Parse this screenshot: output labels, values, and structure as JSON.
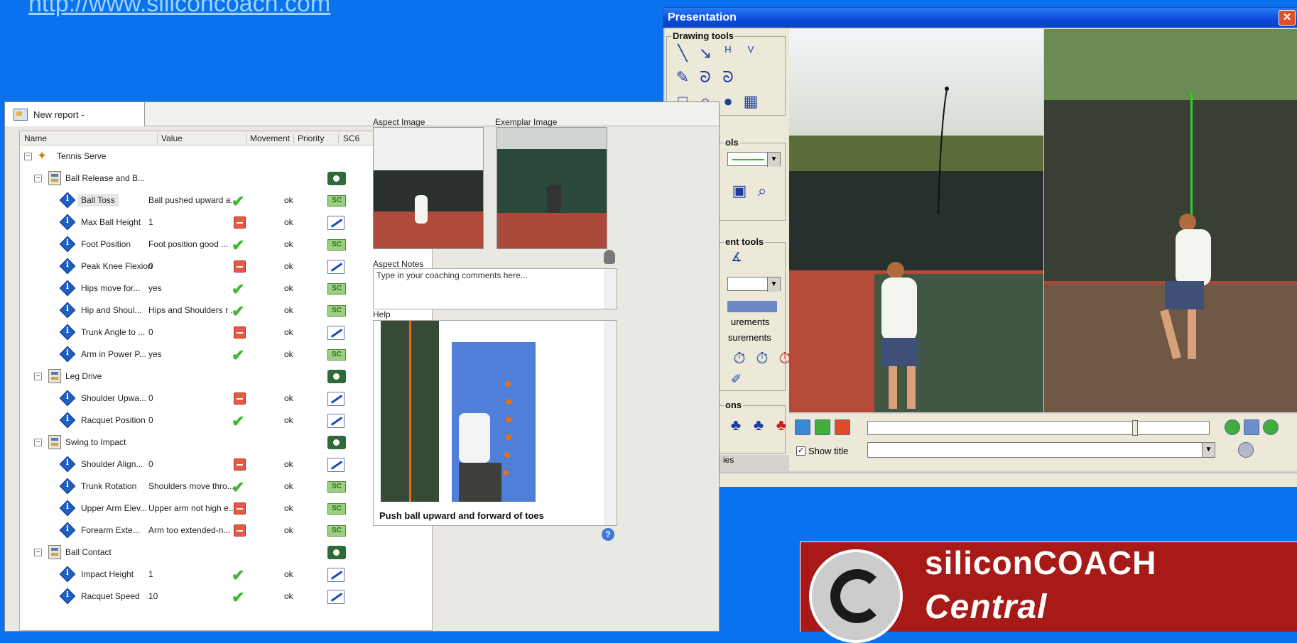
{
  "top_link": "http://www.siliconcoach.com",
  "presentation": {
    "title": "Presentation",
    "close_label": "✕",
    "groups": {
      "drawing_tools": "Drawing tools",
      "tools_partial": "ols",
      "measurement_tools_partial": "ent tools",
      "actions_partial": "ons"
    },
    "measurements_label_1": "urements",
    "measurements_label_2": "surements",
    "series_partial": "ies",
    "show_title_label": "Show title",
    "show_title_checked": "✓"
  },
  "report": {
    "tab_label": "New report -",
    "columns": {
      "name": "Name",
      "value": "Value",
      "movement": "Movement",
      "priority": "Priority",
      "sc6": "SC6"
    },
    "root": "Tennis Serve",
    "aspect_image_label": "Aspect Image",
    "exemplar_image_label": "Exemplar Image",
    "aspect_notes_label": "Aspect Notes",
    "notes_placeholder": "Type in your coaching comments here...",
    "help_label": "Help",
    "help_caption": "Push ball upward and forward of toes",
    "help_icon": "?"
  },
  "rows": [
    {
      "type": "group",
      "name": "Ball Release and B...",
      "icon": "camera"
    },
    {
      "type": "item",
      "name": "Ball Toss",
      "value": "Ball pushed upward a...",
      "movement": "check",
      "priority": "ok",
      "icon": "link",
      "selected": true
    },
    {
      "type": "item",
      "name": "Max Ball Height",
      "value": "1",
      "movement": "minus",
      "priority": "ok",
      "icon": "edit"
    },
    {
      "type": "item",
      "name": "Foot Position",
      "value": "Foot position good  ...",
      "movement": "check",
      "priority": "ok",
      "icon": "link"
    },
    {
      "type": "item",
      "name": "Peak Knee Flexion",
      "value": "0",
      "movement": "minus",
      "priority": "ok",
      "icon": "edit"
    },
    {
      "type": "item",
      "name": "Hips move for...",
      "value": "yes",
      "movement": "check",
      "priority": "ok",
      "icon": "link"
    },
    {
      "type": "item",
      "name": "Hip and Shoul...",
      "value": "Hips and Shoulders r  ...",
      "movement": "check",
      "priority": "ok",
      "icon": "link"
    },
    {
      "type": "item",
      "name": "Trunk Angle to ...",
      "value": "0",
      "movement": "minus",
      "priority": "ok",
      "icon": "edit"
    },
    {
      "type": "item",
      "name": "Arm in Power P...",
      "value": "yes",
      "movement": "check",
      "priority": "ok",
      "icon": "link"
    },
    {
      "type": "group",
      "name": "Leg Drive",
      "icon": "camera"
    },
    {
      "type": "item",
      "name": "Shoulder Upwa...",
      "value": "0",
      "movement": "minus",
      "priority": "ok",
      "icon": "edit"
    },
    {
      "type": "item",
      "name": "Racquet Position",
      "value": "0",
      "movement": "check",
      "priority": "ok",
      "icon": "edit"
    },
    {
      "type": "group",
      "name": "Swing to Impact",
      "icon": "camera"
    },
    {
      "type": "item",
      "name": "Shoulder Align...",
      "value": "0",
      "movement": "minus",
      "priority": "ok",
      "icon": "edit"
    },
    {
      "type": "item",
      "name": "Trunk Rotation",
      "value": "Shoulders move thro...",
      "movement": "check",
      "priority": "ok",
      "icon": "link"
    },
    {
      "type": "item",
      "name": "Upper Arm Elev...",
      "value": "Upper arm not high e...",
      "movement": "minus",
      "priority": "ok",
      "icon": "link"
    },
    {
      "type": "item",
      "name": "Forearm Exte...",
      "value": "Arm too extended-n...",
      "movement": "minus",
      "priority": "ok",
      "icon": "link"
    },
    {
      "type": "group",
      "name": "Ball Contact",
      "icon": "camera"
    },
    {
      "type": "item",
      "name": "Impact Height",
      "value": "1",
      "movement": "check",
      "priority": "ok",
      "icon": "edit"
    },
    {
      "type": "item",
      "name": "Racquet Speed",
      "value": "10",
      "movement": "check",
      "priority": "ok",
      "icon": "edit"
    }
  ],
  "logo": {
    "name": "siliconCOACH",
    "sub": "Central"
  },
  "colors": {
    "background": "#0a72ee",
    "logo": "#a81a17",
    "check": "#3fb733",
    "minus": "#e55a45"
  }
}
